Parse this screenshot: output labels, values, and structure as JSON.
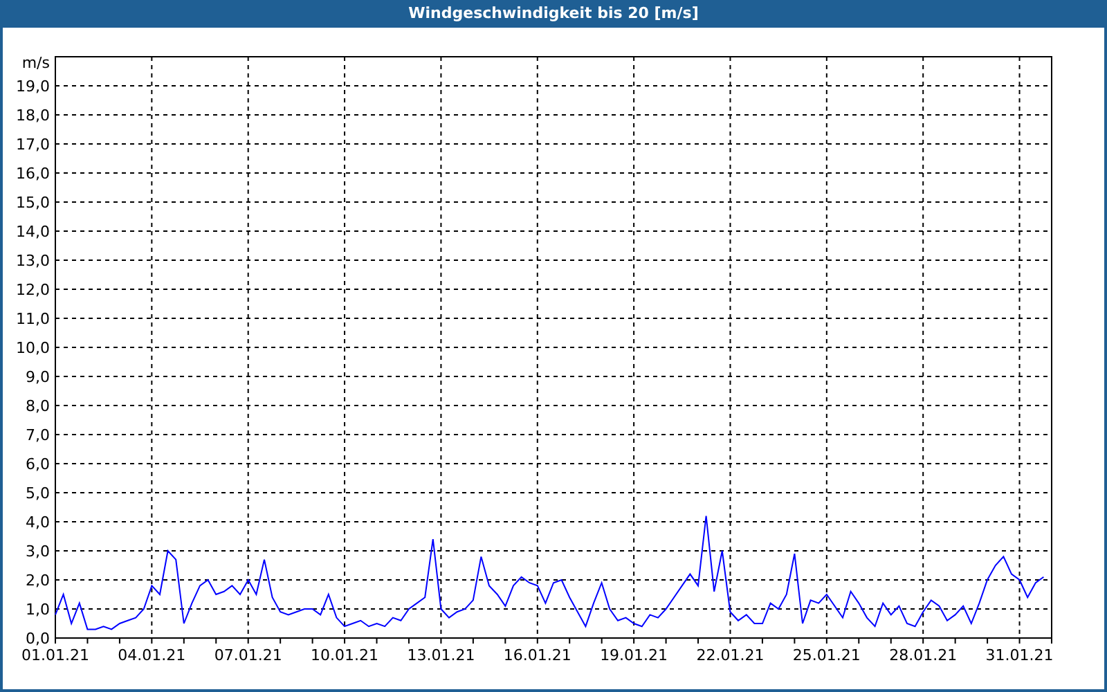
{
  "window": {
    "title": "Windgeschwindigkeit bis 20 [m/s]"
  },
  "chart": {
    "chart_data": {
      "type": "line",
      "grid": true,
      "ylabel": "m/s",
      "ylim": [
        0,
        20
      ],
      "yticks": [
        {
          "value": 0,
          "label": "0,0"
        },
        {
          "value": 1,
          "label": "1,0"
        },
        {
          "value": 2,
          "label": "2,0"
        },
        {
          "value": 3,
          "label": "3,0"
        },
        {
          "value": 4,
          "label": "4,0"
        },
        {
          "value": 5,
          "label": "5,0"
        },
        {
          "value": 6,
          "label": "6,0"
        },
        {
          "value": 7,
          "label": "7,0"
        },
        {
          "value": 8,
          "label": "8,0"
        },
        {
          "value": 9,
          "label": "9,0"
        },
        {
          "value": 10,
          "label": "10,0"
        },
        {
          "value": 11,
          "label": "11,0"
        },
        {
          "value": 12,
          "label": "12,0"
        },
        {
          "value": 13,
          "label": "13,0"
        },
        {
          "value": 14,
          "label": "14,0"
        },
        {
          "value": 15,
          "label": "15,0"
        },
        {
          "value": 16,
          "label": "16,0"
        },
        {
          "value": 17,
          "label": "17,0"
        },
        {
          "value": 18,
          "label": "18,0"
        },
        {
          "value": 19,
          "label": "19,0"
        }
      ],
      "categories": [
        "01.01.21",
        null,
        null,
        null,
        null,
        null,
        null,
        null,
        null,
        null,
        null,
        null,
        "04.01.21",
        null,
        null,
        null,
        null,
        null,
        null,
        null,
        null,
        null,
        null,
        null,
        "07.01.21",
        null,
        null,
        null,
        null,
        null,
        null,
        null,
        null,
        null,
        null,
        null,
        "10.01.21",
        null,
        null,
        null,
        null,
        null,
        null,
        null,
        null,
        null,
        null,
        null,
        "13.01.21",
        null,
        null,
        null,
        null,
        null,
        null,
        null,
        null,
        null,
        null,
        null,
        "16.01.21",
        null,
        null,
        null,
        null,
        null,
        null,
        null,
        null,
        null,
        null,
        null,
        "19.01.21",
        null,
        null,
        null,
        null,
        null,
        null,
        null,
        null,
        null,
        null,
        null,
        "22.01.21",
        null,
        null,
        null,
        null,
        null,
        null,
        null,
        null,
        null,
        null,
        null,
        "25.01.21",
        null,
        null,
        null,
        null,
        null,
        null,
        null,
        null,
        null,
        null,
        null,
        "28.01.21",
        null,
        null,
        null,
        null,
        null,
        null,
        null,
        null,
        null,
        null,
        null,
        "31.01.21",
        null,
        null,
        null
      ],
      "series": [
        {
          "color": "#0000ff",
          "values": [
            0.8,
            1.5,
            0.5,
            1.2,
            0.3,
            0.3,
            0.4,
            0.3,
            0.5,
            0.6,
            0.7,
            1.0,
            1.8,
            1.5,
            3.0,
            2.7,
            0.5,
            1.2,
            1.8,
            2.0,
            1.5,
            1.6,
            1.8,
            1.5,
            2.0,
            1.5,
            2.7,
            1.4,
            0.9,
            0.8,
            0.9,
            1.0,
            1.0,
            0.8,
            1.5,
            0.7,
            0.4,
            0.5,
            0.6,
            0.4,
            0.5,
            0.4,
            0.7,
            0.6,
            1.0,
            1.2,
            1.4,
            3.4,
            1.0,
            0.7,
            0.9,
            1.0,
            1.3,
            2.8,
            1.8,
            1.5,
            1.1,
            1.8,
            2.1,
            1.9,
            1.8,
            1.2,
            1.9,
            2.0,
            1.4,
            0.9,
            0.4,
            1.2,
            1.9,
            1.0,
            0.6,
            0.7,
            0.5,
            0.4,
            0.8,
            0.7,
            1.0,
            1.4,
            1.8,
            2.2,
            1.8,
            4.2,
            1.6,
            3.0,
            0.9,
            0.6,
            0.8,
            0.5,
            0.5,
            1.2,
            1.0,
            1.5,
            2.9,
            0.5,
            1.3,
            1.2,
            1.5,
            1.1,
            0.7,
            1.6,
            1.2,
            0.7,
            0.4,
            1.2,
            0.8,
            1.1,
            0.5,
            0.4,
            0.9,
            1.3,
            1.1,
            0.6,
            0.8,
            1.1,
            0.5,
            1.2,
            2.0,
            2.5,
            2.8,
            2.2,
            2.0,
            1.4,
            1.9,
            2.1
          ]
        }
      ]
    }
  }
}
